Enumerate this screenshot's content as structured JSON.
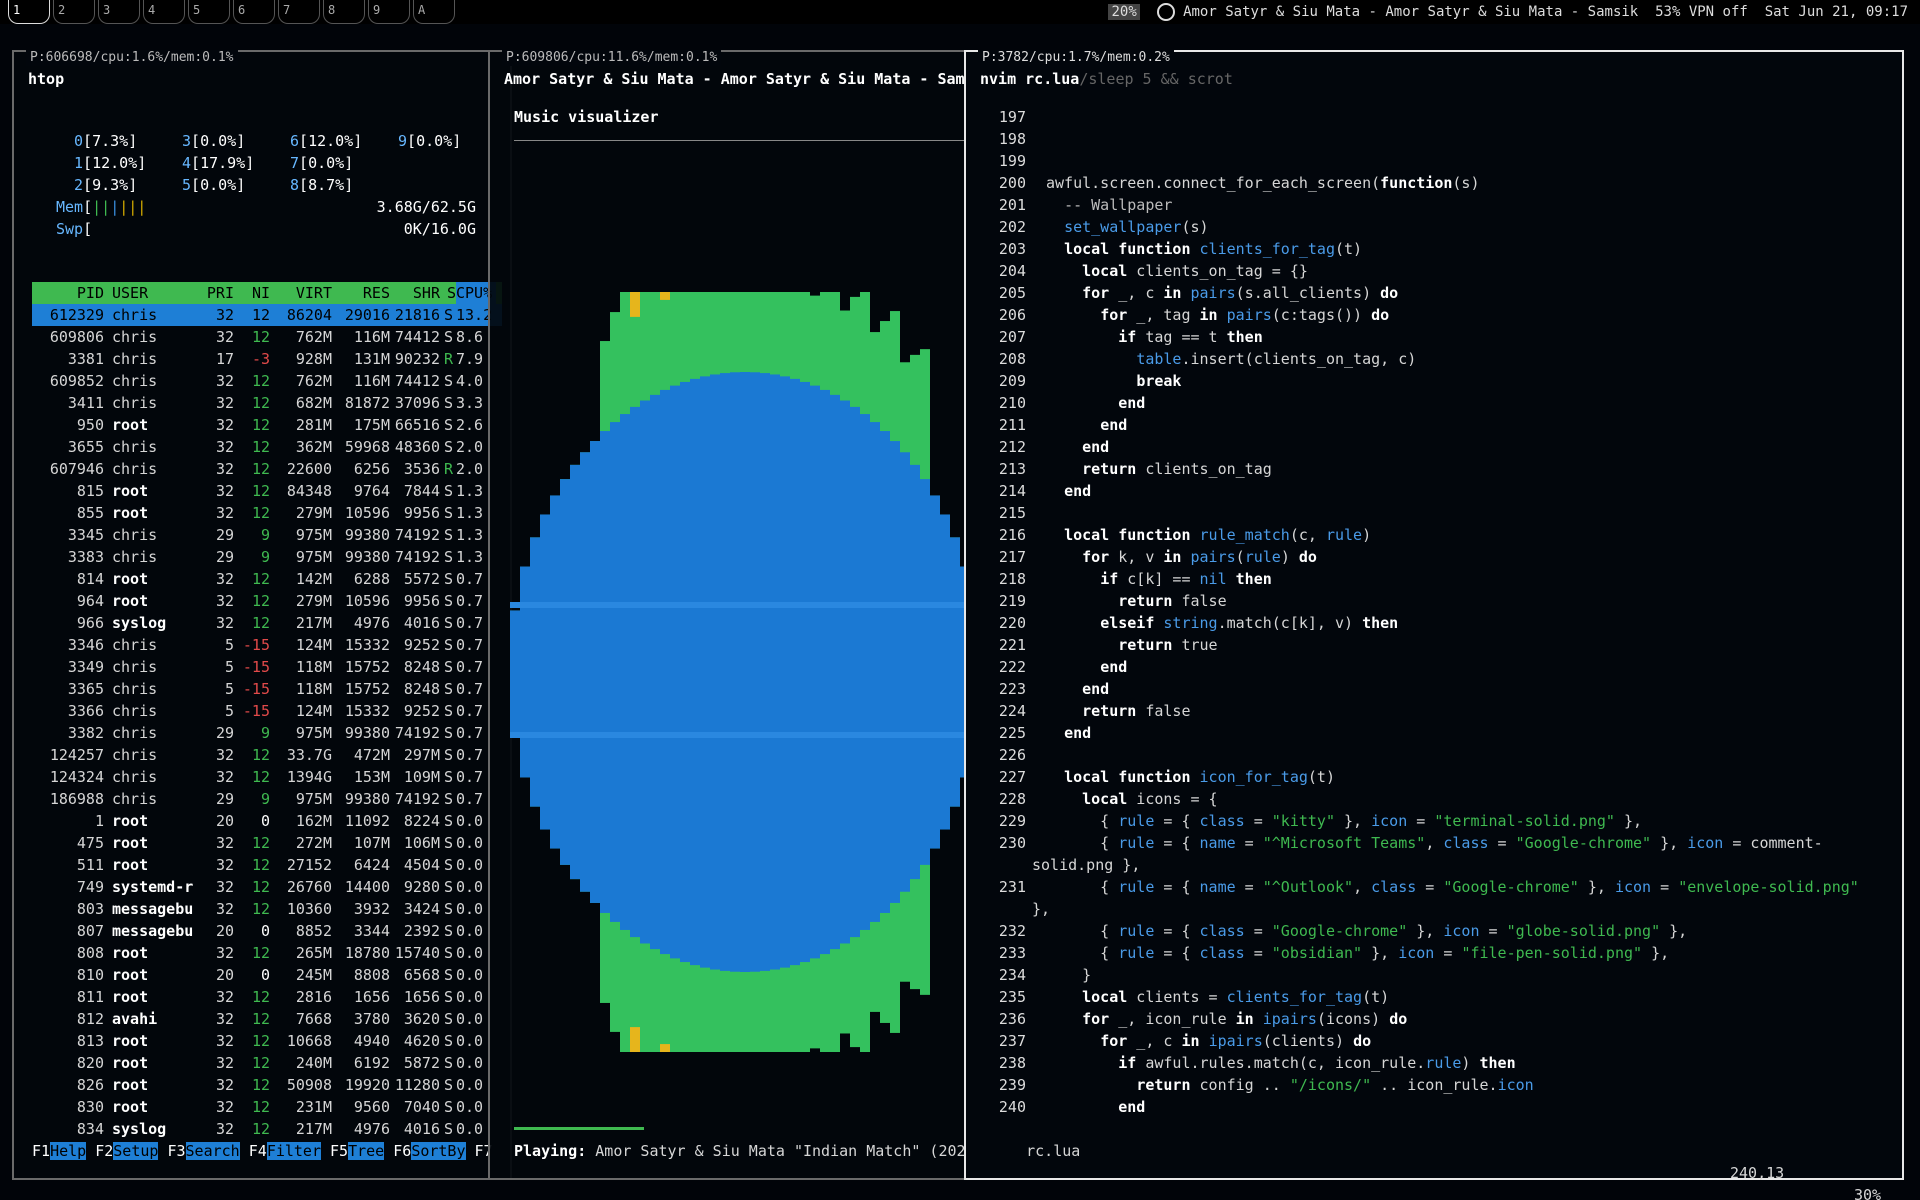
{
  "topbar": {
    "tags": [
      {
        "n": "1",
        "active": true
      },
      {
        "n": "2"
      },
      {
        "n": "3"
      },
      {
        "n": "4"
      },
      {
        "n": "5"
      },
      {
        "n": "6"
      },
      {
        "n": "7"
      },
      {
        "n": "8"
      },
      {
        "n": "9"
      },
      {
        "n": "A"
      }
    ],
    "volume": "20%",
    "now_playing": "Amor Satyr & Siu Mata - Amor Satyr & Siu Mata - Samsik",
    "battery": "53%",
    "vpn": "VPN off",
    "clock": "Sat Jun 21, 09:17"
  },
  "htop": {
    "win_title": "P:606698/cpu:1.6%/mem:0.1%",
    "title": "htop",
    "cpus": [
      {
        "id": "0",
        "pct": "7.3%"
      },
      {
        "id": "3",
        "pct": "0.0%"
      },
      {
        "id": "6",
        "pct": "12.0%"
      },
      {
        "id": "9",
        "pct": "0.0%"
      },
      {
        "id": "1",
        "pct": "12.0%"
      },
      {
        "id": "4",
        "pct": "17.9%"
      },
      {
        "id": "7",
        "pct": "0.0%"
      },
      {
        "id": "2",
        "pct": "9.3%"
      },
      {
        "id": "5",
        "pct": "0.0%"
      },
      {
        "id": "8",
        "pct": "8.7%"
      }
    ],
    "mem": "3.68G/62.5G",
    "swp": "0K/16.0G",
    "columns": [
      "PID",
      "USER",
      "PRI",
      "NI",
      "VIRT",
      "RES",
      "SHR",
      "S",
      "CPU%"
    ],
    "rows": [
      [
        "612329",
        "chris",
        "32",
        "12",
        "86204",
        "29016",
        "21816",
        "S",
        "13.2"
      ],
      [
        "609806",
        "chris",
        "32",
        "12",
        "762M",
        "116M",
        "74412",
        "S",
        "8.6"
      ],
      [
        "3381",
        "chris",
        "17",
        "-3",
        "928M",
        "131M",
        "90232",
        "R",
        "7.9"
      ],
      [
        "609852",
        "chris",
        "32",
        "12",
        "762M",
        "116M",
        "74412",
        "S",
        "4.0"
      ],
      [
        "3411",
        "chris",
        "32",
        "12",
        "682M",
        "81872",
        "37096",
        "S",
        "3.3"
      ],
      [
        "950",
        "root",
        "32",
        "12",
        "281M",
        "175M",
        "66516",
        "S",
        "2.6"
      ],
      [
        "3655",
        "chris",
        "32",
        "12",
        "362M",
        "59968",
        "48360",
        "S",
        "2.0"
      ],
      [
        "607946",
        "chris",
        "32",
        "12",
        "22600",
        "6256",
        "3536",
        "R",
        "2.0"
      ],
      [
        "815",
        "root",
        "32",
        "12",
        "84348",
        "9764",
        "7844",
        "S",
        "1.3"
      ],
      [
        "855",
        "root",
        "32",
        "12",
        "279M",
        "10596",
        "9956",
        "S",
        "1.3"
      ],
      [
        "3345",
        "chris",
        "29",
        "9",
        "975M",
        "99380",
        "74192",
        "S",
        "1.3"
      ],
      [
        "3383",
        "chris",
        "29",
        "9",
        "975M",
        "99380",
        "74192",
        "S",
        "1.3"
      ],
      [
        "814",
        "root",
        "32",
        "12",
        "142M",
        "6288",
        "5572",
        "S",
        "0.7"
      ],
      [
        "964",
        "root",
        "32",
        "12",
        "279M",
        "10596",
        "9956",
        "S",
        "0.7"
      ],
      [
        "966",
        "syslog",
        "32",
        "12",
        "217M",
        "4976",
        "4016",
        "S",
        "0.7"
      ],
      [
        "3346",
        "chris",
        "5",
        "-15",
        "124M",
        "15332",
        "9252",
        "S",
        "0.7"
      ],
      [
        "3349",
        "chris",
        "5",
        "-15",
        "118M",
        "15752",
        "8248",
        "S",
        "0.7"
      ],
      [
        "3365",
        "chris",
        "5",
        "-15",
        "118M",
        "15752",
        "8248",
        "S",
        "0.7"
      ],
      [
        "3366",
        "chris",
        "5",
        "-15",
        "124M",
        "15332",
        "9252",
        "S",
        "0.7"
      ],
      [
        "3382",
        "chris",
        "29",
        "9",
        "975M",
        "99380",
        "74192",
        "S",
        "0.7"
      ],
      [
        "124257",
        "chris",
        "32",
        "12",
        "33.7G",
        "472M",
        "297M",
        "S",
        "0.7"
      ],
      [
        "124324",
        "chris",
        "32",
        "12",
        "1394G",
        "153M",
        "109M",
        "S",
        "0.7"
      ],
      [
        "186988",
        "chris",
        "29",
        "9",
        "975M",
        "99380",
        "74192",
        "S",
        "0.7"
      ],
      [
        "1",
        "root",
        "20",
        "0",
        "162M",
        "11092",
        "8224",
        "S",
        "0.0"
      ],
      [
        "475",
        "root",
        "32",
        "12",
        "272M",
        "107M",
        "106M",
        "S",
        "0.0"
      ],
      [
        "511",
        "root",
        "32",
        "12",
        "27152",
        "6424",
        "4504",
        "S",
        "0.0"
      ],
      [
        "749",
        "systemd-r",
        "32",
        "12",
        "26760",
        "14400",
        "9280",
        "S",
        "0.0"
      ],
      [
        "803",
        "messagebu",
        "32",
        "12",
        "10360",
        "3932",
        "3424",
        "S",
        "0.0"
      ],
      [
        "807",
        "messagebu",
        "20",
        "0",
        "8852",
        "3344",
        "2392",
        "S",
        "0.0"
      ],
      [
        "808",
        "root",
        "32",
        "12",
        "265M",
        "18780",
        "15740",
        "S",
        "0.0"
      ],
      [
        "810",
        "root",
        "20",
        "0",
        "245M",
        "8808",
        "6568",
        "S",
        "0.0"
      ],
      [
        "811",
        "root",
        "32",
        "12",
        "2816",
        "1656",
        "1656",
        "S",
        "0.0"
      ],
      [
        "812",
        "avahi",
        "32",
        "12",
        "7668",
        "3780",
        "3620",
        "S",
        "0.0"
      ],
      [
        "813",
        "root",
        "32",
        "12",
        "10668",
        "4940",
        "4620",
        "S",
        "0.0"
      ],
      [
        "820",
        "root",
        "32",
        "12",
        "240M",
        "6192",
        "5872",
        "S",
        "0.0"
      ],
      [
        "826",
        "root",
        "32",
        "12",
        "50908",
        "19920",
        "11280",
        "S",
        "0.0"
      ],
      [
        "830",
        "root",
        "32",
        "12",
        "231M",
        "9560",
        "7040",
        "S",
        "0.0"
      ],
      [
        "834",
        "syslog",
        "32",
        "12",
        "217M",
        "4976",
        "4016",
        "S",
        "0.0"
      ]
    ],
    "fkeys": [
      {
        "k": "F1",
        "l": "Help"
      },
      {
        "k": "F2",
        "l": "Setup"
      },
      {
        "k": "F3",
        "l": "Search"
      },
      {
        "k": "F4",
        "l": "Filter"
      },
      {
        "k": "F5",
        "l": "Tree"
      },
      {
        "k": "F6",
        "l": "SortBy"
      },
      {
        "k": "F7",
        "l": ""
      }
    ]
  },
  "music": {
    "win_title": "P:609806/cpu:11.6%/mem:0.1%",
    "title": "Amor Satyr & Siu Mata - Amor Satyr & Siu Mata - Sam",
    "viz_label": "Music visualizer",
    "playing_label": "Playing:",
    "playing_text": "Amor Satyr & Siu Mata \"Indian Match\" (202"
  },
  "nvim": {
    "win_title": "P:3782/cpu:1.7%/mem:0.2%",
    "title": "nvim rc.lua",
    "title_dim": "/sleep 5 && scrot",
    "status_file": "rc.lua",
    "status_pos": "240,13",
    "status_pct": "30%",
    "lines": [
      {
        "n": "197",
        "t": ""
      },
      {
        "n": "198",
        "t": ""
      },
      {
        "n": "199",
        "t": ""
      },
      {
        "n": "200",
        "t": "awful.screen.connect_for_each_screen(function(s)"
      },
      {
        "n": "201",
        "t": "  -- Wallpaper"
      },
      {
        "n": "202",
        "t": "  set_wallpaper(s)"
      },
      {
        "n": "203",
        "t": "  local function clients_for_tag(t)"
      },
      {
        "n": "204",
        "t": "    local clients_on_tag = {}"
      },
      {
        "n": "205",
        "t": "    for _, c in pairs(s.all_clients) do"
      },
      {
        "n": "206",
        "t": "      for _, tag in pairs(c:tags()) do"
      },
      {
        "n": "207",
        "t": "        if tag == t then"
      },
      {
        "n": "208",
        "t": "          table.insert(clients_on_tag, c)"
      },
      {
        "n": "209",
        "t": "          break"
      },
      {
        "n": "210",
        "t": "        end"
      },
      {
        "n": "211",
        "t": "      end"
      },
      {
        "n": "212",
        "t": "    end"
      },
      {
        "n": "213",
        "t": "    return clients_on_tag"
      },
      {
        "n": "214",
        "t": "  end"
      },
      {
        "n": "215",
        "t": ""
      },
      {
        "n": "216",
        "t": "  local function rule_match(c, rule)"
      },
      {
        "n": "217",
        "t": "    for k, v in pairs(rule) do"
      },
      {
        "n": "218",
        "t": "      if c[k] == nil then"
      },
      {
        "n": "219",
        "t": "        return false"
      },
      {
        "n": "220",
        "t": "      elseif string.match(c[k], v) then"
      },
      {
        "n": "221",
        "t": "        return true"
      },
      {
        "n": "222",
        "t": "      end"
      },
      {
        "n": "223",
        "t": "    end"
      },
      {
        "n": "224",
        "t": "    return false"
      },
      {
        "n": "225",
        "t": "  end"
      },
      {
        "n": "226",
        "t": ""
      },
      {
        "n": "227",
        "t": "  local function icon_for_tag(t)"
      },
      {
        "n": "228",
        "t": "    local icons = {"
      },
      {
        "n": "229",
        "t": "      { rule = { class = \"kitty\" }, icon = \"terminal-solid.png\" },"
      },
      {
        "n": "230",
        "t": "      { rule = { name = \"^Microsoft Teams\", class = \"Google-chrome\" }, icon = \"comment-"
      },
      {
        "n": "",
        "t": "solid.png\" },"
      },
      {
        "n": "231",
        "t": "      { rule = { name = \"^Outlook\", class = \"Google-chrome\" }, icon = \"envelope-solid.png\""
      },
      {
        "n": "",
        "t": "},"
      },
      {
        "n": "232",
        "t": "      { rule = { class = \"Google-chrome\" }, icon = \"globe-solid.png\" },"
      },
      {
        "n": "233",
        "t": "      { rule = { class = \"obsidian\" }, icon = \"file-pen-solid.png\" },"
      },
      {
        "n": "234",
        "t": "    }"
      },
      {
        "n": "235",
        "t": "    local clients = clients_for_tag(t)"
      },
      {
        "n": "236",
        "t": "    for _, icon_rule in ipairs(icons) do"
      },
      {
        "n": "237",
        "t": "      for _, c in ipairs(clients) do"
      },
      {
        "n": "238",
        "t": "        if awful.rules.match(c, icon_rule.rule) then"
      },
      {
        "n": "239",
        "t": "          return config .. \"/icons/\" .. icon_rule.icon"
      },
      {
        "n": "240",
        "t": "        end"
      }
    ]
  }
}
